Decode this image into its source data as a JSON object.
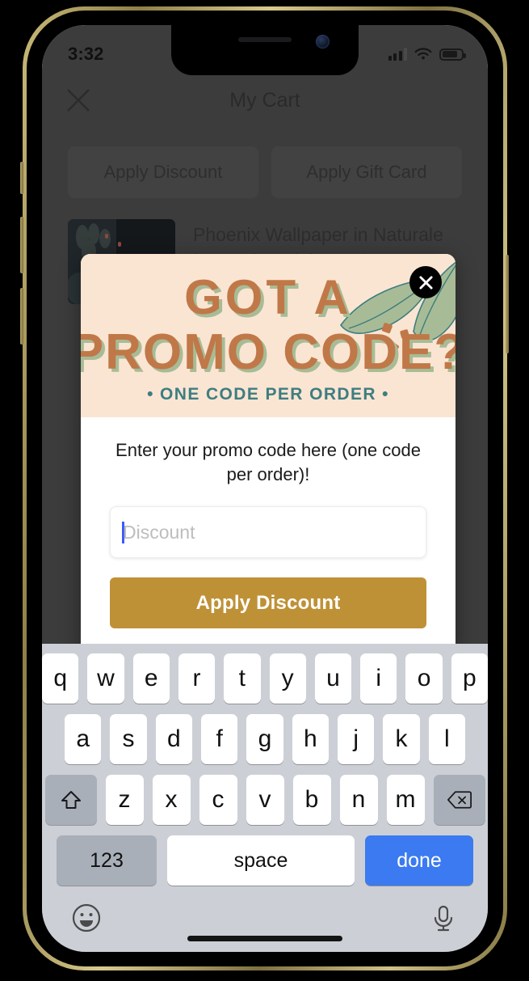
{
  "status_bar": {
    "time": "3:32",
    "cellular_icon": "signal-bars-icon",
    "wifi_icon": "wifi-icon",
    "battery_icon": "battery-icon"
  },
  "app": {
    "title": "My Cart",
    "close_icon": "close-x-icon",
    "actions": [
      {
        "label": "Apply Discount",
        "name": "apply-discount-button"
      },
      {
        "label": "Apply Gift Card",
        "name": "apply-gift-card-button"
      }
    ],
    "cart_item": {
      "title": "Phoenix Wallpaper in Naturale by Justina Blakeney® - Sure…",
      "thumbnail_icon": "product-thumbnail-botanical-wallpaper"
    }
  },
  "modal": {
    "banner": {
      "headline_line1": "GOT A",
      "headline_line2": "PROMO CODE?",
      "tagline": "• ONE CODE PER ORDER •",
      "leaf_icon": "leaf-decoration-icon",
      "confetti_icon": "confetti-squares-icon"
    },
    "close_icon": "close-x-icon",
    "body_text": "Enter your promo code here (one code per order)!",
    "input": {
      "value": "",
      "placeholder": "Discount"
    },
    "submit_label": "Apply Discount",
    "colors": {
      "banner_bg": "#FAE5D3",
      "headline": "#C07848",
      "headline_shadow": "#9BB08C",
      "tagline": "#3E7D80",
      "button": "#BF9137",
      "caret": "#3B5AFE"
    }
  },
  "keyboard": {
    "row1": [
      "q",
      "w",
      "e",
      "r",
      "t",
      "y",
      "u",
      "i",
      "o",
      "p"
    ],
    "row2": [
      "a",
      "s",
      "d",
      "f",
      "g",
      "h",
      "j",
      "k",
      "l"
    ],
    "row3": [
      "z",
      "x",
      "c",
      "v",
      "b",
      "n",
      "m"
    ],
    "shift_icon": "shift-arrow-icon",
    "backspace_icon": "backspace-delete-icon",
    "numbers_label": "123",
    "space_label": "space",
    "done_label": "done",
    "emoji_icon": "emoji-smiley-icon",
    "mic_icon": "microphone-icon"
  }
}
